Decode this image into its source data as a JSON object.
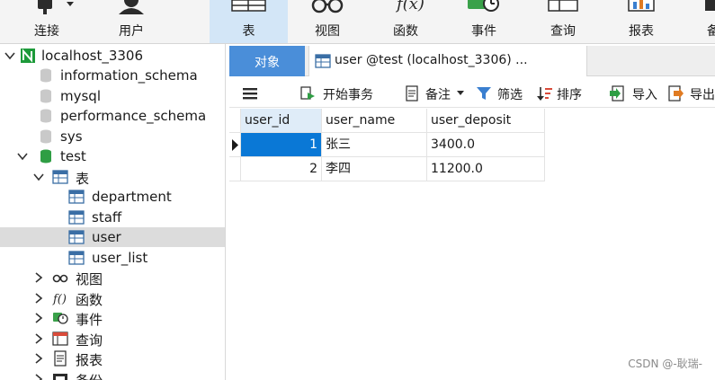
{
  "toolbar": {
    "items": [
      {
        "label": "连接",
        "icon": "connect-icon"
      },
      {
        "label": "用户",
        "icon": "user-icon"
      },
      {
        "label": "表",
        "icon": "table-icon",
        "active": true
      },
      {
        "label": "视图",
        "icon": "view-glasses-icon"
      },
      {
        "label": "函数",
        "icon": "function-icon"
      },
      {
        "label": "事件",
        "icon": "event-icon"
      },
      {
        "label": "查询",
        "icon": "query-icon"
      },
      {
        "label": "报表",
        "icon": "report-icon"
      },
      {
        "label": "备",
        "icon": "backup-icon"
      }
    ],
    "active_color": "#d3e6f7"
  },
  "nav": {
    "connection": "localhost_3306",
    "databases": [
      "information_schema",
      "mysql",
      "performance_schema",
      "sys"
    ],
    "open_db": "test",
    "tables_group": "表",
    "tables": [
      "department",
      "staff",
      "user",
      "user_list"
    ],
    "selected_table": "user",
    "groups": [
      "视图",
      "函数",
      "事件",
      "查询",
      "报表",
      "备份"
    ]
  },
  "tabs": {
    "objects": "对象",
    "query": "user @test (localhost_3306) ..."
  },
  "subbar": {
    "begin_transaction": "开始事务",
    "note": "备注",
    "filter": "筛选",
    "sort": "排序",
    "import": "导入",
    "export": "导出"
  },
  "grid": {
    "columns": [
      "user_id",
      "user_name",
      "user_deposit"
    ],
    "rows": [
      [
        "1",
        "张三",
        "3400.0"
      ],
      [
        "2",
        "李四",
        "11200.0"
      ]
    ]
  },
  "watermark": "CSDN @-耿瑞-",
  "colors": {
    "tab_active": "#4a8ed9",
    "selection": "#0a78d6",
    "header_sorted": "#dfecf8",
    "tree_selected": "#dcdcdc"
  }
}
